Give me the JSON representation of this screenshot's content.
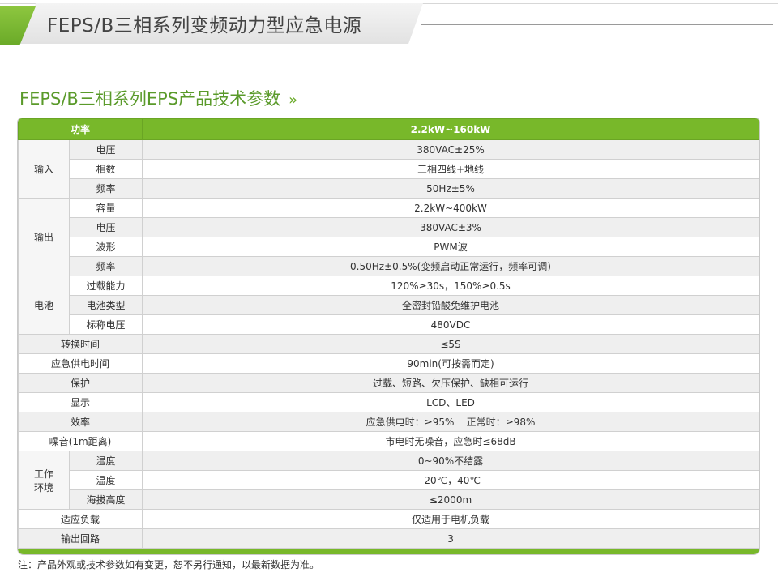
{
  "header": {
    "title": "FEPS/B三相系列变频动力型应急电源"
  },
  "section": {
    "title": "FEPS/B三相系列EPS产品技术参数",
    "arrow": "»"
  },
  "table": {
    "head": {
      "label": "功率",
      "value": "2.2kW~160kW"
    },
    "groups": {
      "input": {
        "label": "输入",
        "rows": [
          {
            "label": "电压",
            "value": "380VAC±25%"
          },
          {
            "label": "相数",
            "value": "三相四线+地线"
          },
          {
            "label": "频率",
            "value": "50Hz±5%"
          }
        ]
      },
      "output": {
        "label": "输出",
        "rows": [
          {
            "label": "容量",
            "value": "2.2kW~400kW"
          },
          {
            "label": "电压",
            "value": "380VAC±3%"
          },
          {
            "label": "波形",
            "value": "PWM波"
          },
          {
            "label": "频率",
            "value": "0.50Hz±0.5%(变频启动正常运行，频率可调)"
          }
        ]
      },
      "battery": {
        "label": "电池",
        "rows": [
          {
            "label": "过载能力",
            "value": "120%≥30s，150%≥0.5s"
          },
          {
            "label": "电池类型",
            "value": "全密封铅酸免维护电池"
          },
          {
            "label": "标称电压",
            "value": "480VDC"
          }
        ]
      },
      "env": {
        "label_line1": "工作",
        "label_line2": "环境",
        "rows": [
          {
            "label": "湿度",
            "value": "0~90%不结露"
          },
          {
            "label": "温度",
            "value": "-20℃，40℃"
          },
          {
            "label": "海拔高度",
            "value": "≤2000m"
          }
        ]
      }
    },
    "singles": {
      "switch_time": {
        "label": "转换时间",
        "value": "≤5S"
      },
      "emergency_time": {
        "label": "应急供电时间",
        "value": "90min(可按需而定)"
      },
      "protection": {
        "label": "保护",
        "value": "过载、短路、欠压保护、缺相可运行"
      },
      "display": {
        "label": "显示",
        "value": "LCD、LED"
      },
      "efficiency": {
        "label": "效率",
        "value": "应急供电时：≥95%    正常时：≥98%"
      },
      "noise": {
        "label": "噪音(1m距离)",
        "value": "市电时无噪音，应急时≤68dB"
      },
      "load": {
        "label": "适应负载",
        "value": "仅适用于电机负载"
      },
      "circuits": {
        "label": "输出回路",
        "value": "3"
      }
    }
  },
  "note": "注：产品外观或技术参数如有变更，恕不另行通知，以最新数据为准。",
  "colors": {
    "accent_green": "#78b82a",
    "title_green": "#5a9a2a",
    "row_alt": "#efefef"
  }
}
